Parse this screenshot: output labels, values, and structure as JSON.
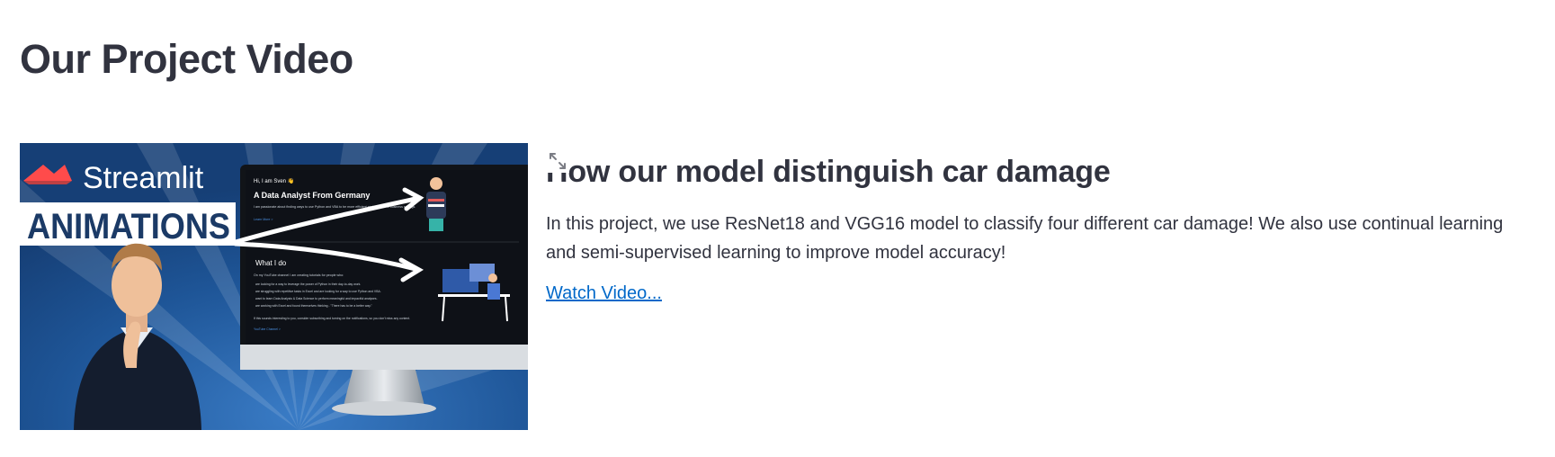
{
  "section": {
    "title": "Our Project Video"
  },
  "thumbnail": {
    "brand_text": "Streamlit",
    "banner_text": "ANIMATIONS",
    "screen": {
      "greeting": "Hi, I am Sven 👋",
      "headline": "A Data Analyst From Germany",
      "intro": "I am passionate about finding ways to use Python and VBA to be more efficient and effective in business settings.",
      "link_more": "Learn More >",
      "section_heading": "What I do",
      "section_intro": "On my YouTube channel I am creating tutorials for people who:",
      "bullets": [
        "are looking for a way to leverage the power of Python in their day-to-day work.",
        "are struggling with repetitive tasks in Excel and are looking for a way to use Python and VBA.",
        "want to learn Data Analysis & Data Science to perform meaningful and impactful analyses.",
        "are working with Excel and found themselves thinking - \"There has to be a better way.\""
      ],
      "footer": "If this sounds interesting to you, consider subscribing and turning on the notifications, so you don't miss any content.",
      "channel_link": "YouTube Channel >"
    },
    "colors": {
      "background": "#1d4e8f",
      "brand_red": "#ff4b4b",
      "banner_text": "#1b3a66"
    }
  },
  "video": {
    "expand_icon": "expand-arrows-icon",
    "title": "How our model distinguish car damage",
    "description": "In this project, we use ResNet18 and VGG16 model to classify four different car damage! We also use continual learning and semi-supervised learning to improve model accuracy!",
    "link_label": "Watch Video..."
  },
  "colors": {
    "text": "#31333f",
    "link": "#0068c9"
  }
}
